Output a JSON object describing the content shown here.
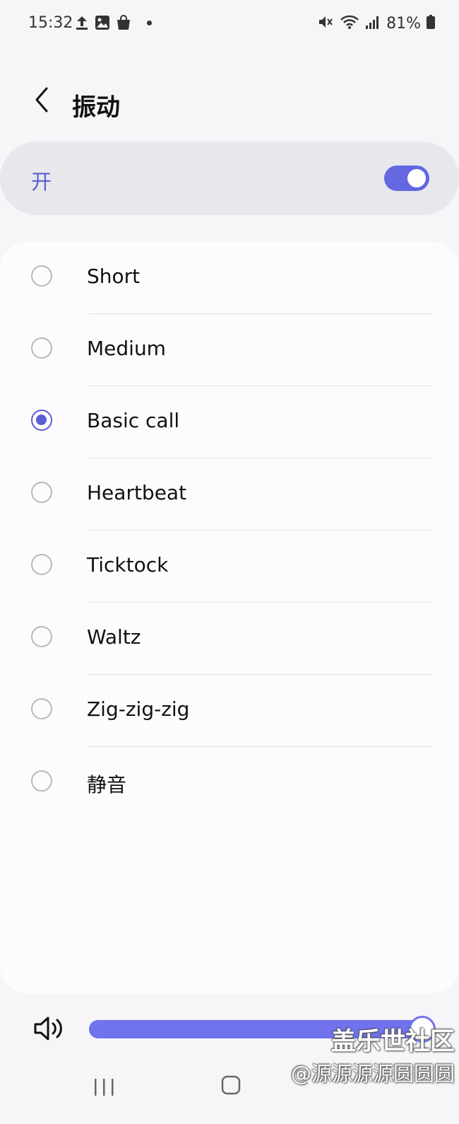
{
  "status_bar": {
    "time": "15:32",
    "battery": "81%",
    "left_icons": [
      "upload-icon",
      "image-icon",
      "shopping-bag-icon",
      "notification-dot-icon"
    ],
    "right_icons": [
      "mute-vibrate-icon",
      "wifi-icon",
      "signal-icon",
      "battery-icon"
    ]
  },
  "header": {
    "title": "振动"
  },
  "master_toggle": {
    "label": "开",
    "on": true
  },
  "options": [
    {
      "label": "Short",
      "selected": false
    },
    {
      "label": "Medium",
      "selected": false
    },
    {
      "label": "Basic call",
      "selected": true
    },
    {
      "label": "Heartbeat",
      "selected": false
    },
    {
      "label": "Ticktock",
      "selected": false
    },
    {
      "label": "Waltz",
      "selected": false
    },
    {
      "label": "Zig-zig-zig",
      "selected": false
    },
    {
      "label": "静音",
      "selected": false
    }
  ],
  "volume": {
    "level_percent": 98
  },
  "watermark": {
    "line1": "盖乐世社区",
    "line2": "@源源源源圆圆圆"
  },
  "colors": {
    "accent": "#5a5fd6",
    "slider": "#7072ee",
    "background": "#f6f6f8"
  }
}
